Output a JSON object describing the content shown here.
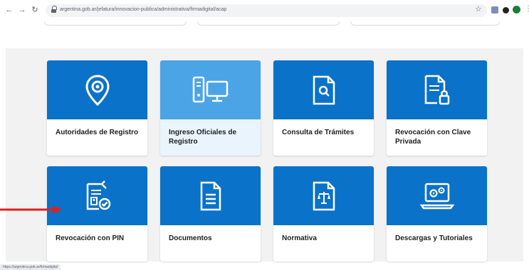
{
  "browser": {
    "url": "argentina.gob.ar/jefatura/innovacion-publica/administrativa/firmadigital/acap",
    "status_url": "https://argentina.gob.ar/firmadigital"
  },
  "tiles": [
    {
      "label": "Autoridades de Registro",
      "icon": "location-pin-icon"
    },
    {
      "label": "Ingreso Oficiales de Registro",
      "icon": "computer-icon"
    },
    {
      "label": "Consulta de Trámites",
      "icon": "document-search-icon"
    },
    {
      "label": "Revocación con Clave Privada",
      "icon": "document-lock-icon"
    },
    {
      "label": "Revocación con PIN",
      "icon": "clipboard-check-icon"
    },
    {
      "label": "Documentos",
      "icon": "document-icon"
    },
    {
      "label": "Normativa",
      "icon": "document-scale-icon"
    },
    {
      "label": "Descargas y Tutoriales",
      "icon": "laptop-gears-icon"
    }
  ],
  "colors": {
    "tile_blue": "#0a72c9",
    "tile_highlight": "#4ba4e6",
    "arrow_red": "#e02020"
  }
}
